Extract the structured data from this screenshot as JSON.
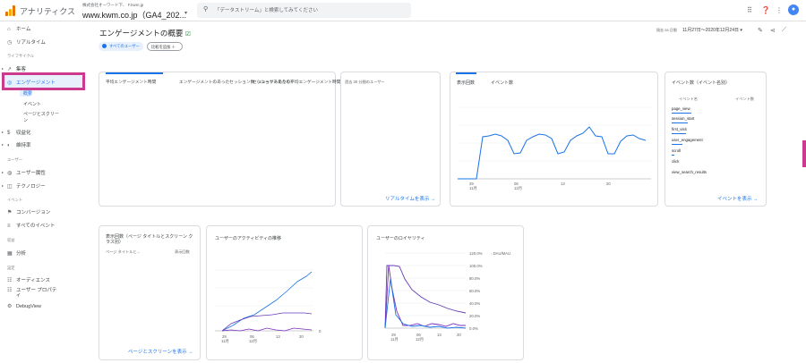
{
  "header": {
    "app_title": "アナリティクス",
    "account_sub": "株式会社オーワード下、 F.kwm.jp",
    "account_main": "www.kwm.co.jp（GA4_202...",
    "search_placeholder": "「データストリーム」と検索してみてください",
    "icons": [
      "grid-icon",
      "help-icon",
      "more-icon"
    ],
    "avatar_initial": "●"
  },
  "sidebar": {
    "items": [
      {
        "label": "ホーム",
        "icon": "⌂"
      },
      {
        "label": "リアルタイム",
        "icon": "◷"
      }
    ],
    "sections": {
      "lifecycle": "ライフサイクル",
      "user": "ユーザー",
      "event": "イベント",
      "monetize": "収益",
      "settings": "設定"
    },
    "lifecycle_items": [
      {
        "label": "集客",
        "icon": "↗"
      },
      {
        "label": "エンゲージメント",
        "icon": "◎"
      },
      {
        "label": "収益化",
        "icon": "$"
      },
      {
        "label": "維持率",
        "icon": "◐"
      }
    ],
    "engagement_subs": [
      "概要",
      "イベント",
      "ページとスクリー",
      "ン"
    ],
    "user_items": [
      {
        "label": "ユーザー属性",
        "icon": "◍"
      },
      {
        "label": "テクノロジー",
        "icon": "◫"
      }
    ],
    "event_items": [
      {
        "label": "コンバージョン",
        "icon": "⚑"
      },
      {
        "label": "すべてのイベント",
        "icon": "≡"
      }
    ],
    "monetize_items": [
      {
        "label": "分析",
        "icon": "▦"
      }
    ],
    "settings_items": [
      {
        "label": "オーディエンス",
        "icon": "☷"
      },
      {
        "label": "ユーザー プロパテ",
        "icon": "☷"
      },
      {
        "label": "イ",
        "icon": ""
      },
      {
        "label": "DebugView",
        "icon": "⚙"
      }
    ]
  },
  "page": {
    "title": "エンゲージメントの概要",
    "title_icon": "☑",
    "chip_all_users": "すべてのユーザー",
    "chip_compare": "比較を追加 ＋",
    "date_small": "過去 28 日間",
    "date_range": "11月27日〜2020年12月24日 ▾"
  },
  "card1": {
    "metrics": [
      "平均エンゲージメント時間",
      "エンゲージメントのあったセッション数（1ユーザーあたり）",
      "セッションあたりの平均エンゲージメント時間"
    ]
  },
  "card2": {
    "title": "過去 30 分間のユーザー",
    "link": "リアルタイムを表示 →"
  },
  "card3": {
    "tabs": [
      "表示回数",
      "イベント数"
    ],
    "x_ticks": [
      {
        "day": "29",
        "month": "11月"
      },
      {
        "day": "06",
        "month": "12月"
      },
      {
        "day": "13",
        "month": ""
      },
      {
        "day": "20",
        "month": ""
      }
    ]
  },
  "card4": {
    "title": "イベント数（イベント名別）",
    "col_name": "イベント名",
    "col_count": "イベント数",
    "events": [
      "page_view",
      "session_start",
      "first_visit",
      "user_engagement",
      "scroll",
      "click",
      "view_search_results"
    ],
    "link": "イベントを表示 →"
  },
  "card5": {
    "title": "表示回数（ページ タイトルとスクリーン クラス別）",
    "col_name": "ページ タイトルと...",
    "col_count": "表示回数",
    "link": "ページとスクリーンを表示 →"
  },
  "card6": {
    "title": "ユーザーのアクティビティの推移",
    "y_tick": "0",
    "x_ticks": [
      {
        "day": "29",
        "month": "11月"
      },
      {
        "day": "06",
        "month": "12月"
      },
      {
        "day": "13",
        "month": ""
      },
      {
        "day": "20",
        "month": ""
      }
    ]
  },
  "card7": {
    "title": "ユーザーのロイヤリティ",
    "legend": "◦ DAU/MAU",
    "y_ticks": [
      "120.0%",
      "100.0%",
      "80.0%",
      "60.0%",
      "40.0%",
      "20.0%",
      "0.0%"
    ],
    "x_ticks": [
      {
        "day": "29",
        "month": "11月"
      },
      {
        "day": "06",
        "month": "12月"
      },
      {
        "day": "13",
        "month": ""
      },
      {
        "day": "20",
        "month": ""
      }
    ]
  },
  "colors": {
    "accent": "#1a73e8",
    "purple": "#673ab7",
    "highlight": "#cc3a8f"
  }
}
